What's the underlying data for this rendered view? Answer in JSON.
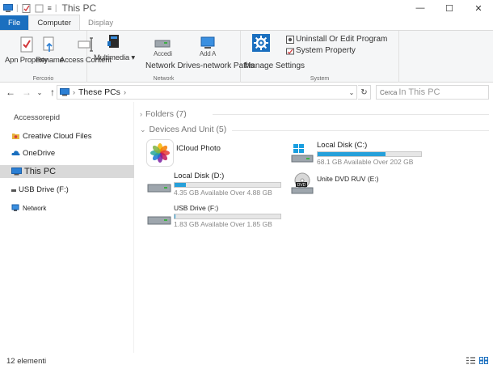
{
  "window": {
    "title": "This PC",
    "minimize": "—",
    "maximize": "☐",
    "close": "✕"
  },
  "tabs": [
    "File",
    "Computer",
    "Display"
  ],
  "ribbon": {
    "groups": [
      {
        "label": "Fercorio",
        "buttons": [
          "Apn Property",
          "Rename",
          "Access Content"
        ]
      },
      {
        "label": "Network",
        "buttons": [
          "Multimedia",
          "Network Drives-network Paths",
          "Manage Settings"
        ],
        "partial_labels": [
          "Accedi",
          "Add A"
        ]
      },
      {
        "label": "System",
        "buttons": [
          "Settings"
        ],
        "small_buttons": [
          "Uninstall Or Edit Program",
          "System Property"
        ]
      }
    ]
  },
  "address": {
    "path": "These PCs",
    "search_prefix": "Cerca",
    "search_placeholder": "In This PC"
  },
  "sidebar": {
    "quick_access": "Accessorepid",
    "items": [
      {
        "label": "Creative Cloud Files",
        "icon": "creative-cloud-icon"
      },
      {
        "label": "OneDrive",
        "icon": "onedrive-icon"
      },
      {
        "label": "This PC",
        "icon": "this-pc-icon",
        "selected": true
      },
      {
        "label": "USB Drive (F:)",
        "icon": "usb-drive-icon"
      },
      {
        "label": "Network",
        "icon": "network-icon"
      }
    ]
  },
  "content": {
    "folders_header": "Folders (7)",
    "devices_header": "Devices And Unit (5)",
    "devices": [
      {
        "name": "ICloud Photo",
        "icon": "icloud-photos-icon"
      },
      {
        "name": "Local Disk (C:)",
        "sub": "68.1 GB Available Over 202 GB",
        "used_fraction": 0.66,
        "icon": "windows-disk-icon"
      },
      {
        "name": "Local Disk (D:)",
        "sub": "4.35 GB Available Over 4.88 GB",
        "used_fraction": 0.11,
        "icon": "disk-icon"
      },
      {
        "name": "Unite DVD RUV (E:)",
        "icon": "dvd-drive-icon"
      },
      {
        "name": "USB Drive (F:)",
        "sub": "1.83 GB Available Over 1.85 GB",
        "used_fraction": 0.01,
        "icon": "usb-disk-icon"
      }
    ]
  },
  "status": {
    "count": "12 elementi"
  },
  "colors": {
    "accent": "#1a6fbf",
    "bar_fill": "#26a0da",
    "selected_bg": "#d9d9d9"
  }
}
